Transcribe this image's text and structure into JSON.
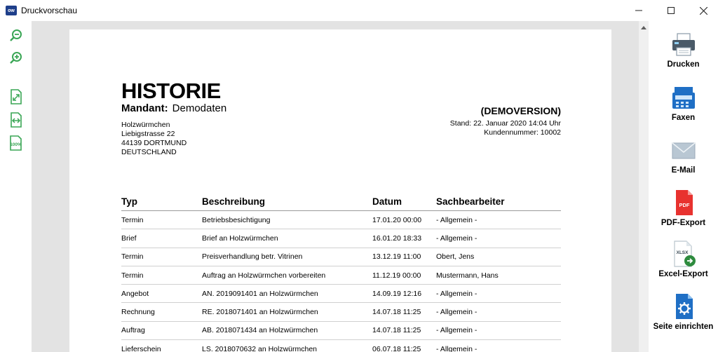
{
  "window": {
    "title": "Druckvorschau",
    "app_badge": "ow"
  },
  "toolbar_left": [
    {
      "icon": "zoom-out-icon"
    },
    {
      "icon": "zoom-in-icon"
    },
    {
      "icon": "fit-page-icon"
    },
    {
      "icon": "fit-width-icon"
    },
    {
      "icon": "zoom-100-icon",
      "text": "100%"
    }
  ],
  "actions": [
    {
      "label": "Drucken",
      "icon": "printer-icon"
    },
    {
      "label": "Faxen",
      "icon": "fax-icon"
    },
    {
      "label": "E-Mail",
      "icon": "mail-icon"
    },
    {
      "label": "PDF-Export",
      "icon": "pdf-icon",
      "badge": "PDF"
    },
    {
      "label": "Excel-Export",
      "icon": "excel-icon",
      "badge": "XLSX"
    },
    {
      "label": "Seite einrichten",
      "icon": "page-setup-icon"
    }
  ],
  "document": {
    "title": "HISTORIE",
    "mandant_label": "Mandant:",
    "mandant_value": "Demodaten",
    "address": [
      "Holzwürmchen",
      "Liebigstrasse 22",
      "44139 DORTMUND",
      "DEUTSCHLAND"
    ],
    "demo": "(DEMOVERSION)",
    "stand": "Stand:  22. Januar 2020 14:04 Uhr",
    "kundennummer": "Kundennummer: 10002",
    "columns": [
      "Typ",
      "Beschreibung",
      "Datum",
      "Sachbearbeiter"
    ],
    "rows": [
      [
        "Termin",
        "Betriebsbesichtigung",
        "17.01.20 00:00",
        "- Allgemein -"
      ],
      [
        "Brief",
        "Brief an Holzwürmchen",
        "16.01.20 18:33",
        "- Allgemein -"
      ],
      [
        "Termin",
        "Preisverhandlung betr. Vitrinen",
        "13.12.19 11:00",
        "Obert, Jens"
      ],
      [
        "Termin",
        "Auftrag an Holzwürmchen vorbereiten",
        "11.12.19 00:00",
        "Mustermann, Hans"
      ],
      [
        "Angebot",
        "AN. 2019091401 an Holzwürmchen",
        "14.09.19 12:16",
        "- Allgemein -"
      ],
      [
        "Rechnung",
        "RE. 2018071401 an Holzwürmchen",
        "14.07.18 11:25",
        "- Allgemein -"
      ],
      [
        "Auftrag",
        "AB. 2018071434 an Holzwürmchen",
        "14.07.18 11:25",
        "- Allgemein -"
      ],
      [
        "Lieferschein",
        "LS. 2018070632 an Holzwürmchen",
        "06.07.18 11:25",
        "- Allgemein -"
      ]
    ]
  },
  "colors": {
    "accent_green": "#3aa655",
    "toolbar_blue": "#1f6fc5",
    "viewer_bg": "#e3e3e3"
  }
}
